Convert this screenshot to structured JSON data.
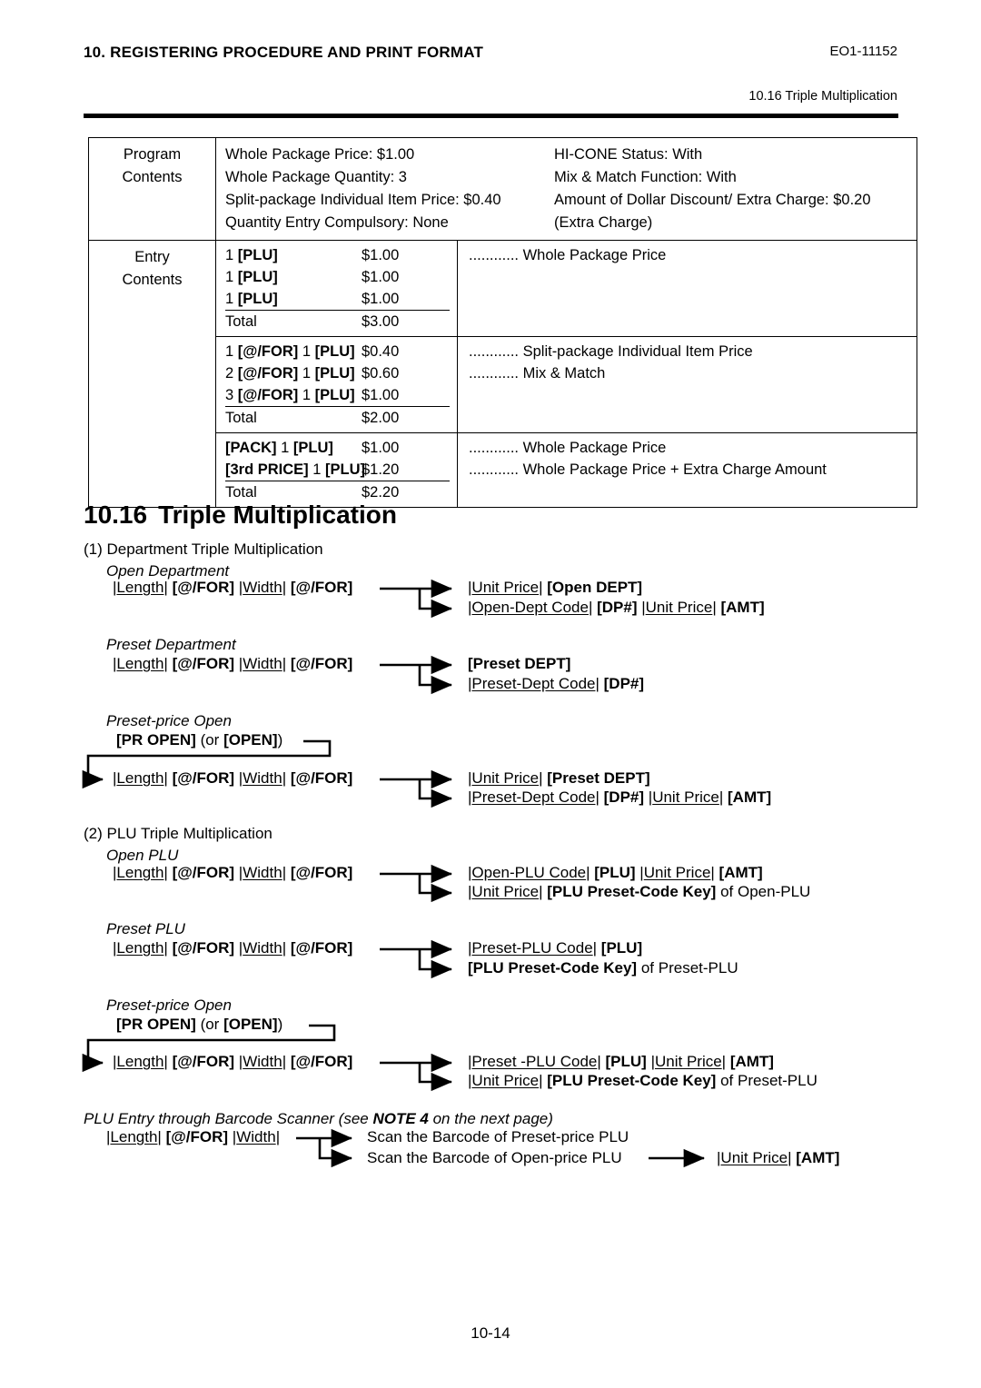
{
  "header": {
    "title": "10. REGISTERING PROCEDURE AND PRINT FORMAT",
    "doc_code": "EO1-11152",
    "subtitle": "10.16 Triple Multiplication"
  },
  "table": {
    "program_label_line1": "Program",
    "program_label_line2": "Contents",
    "program_rows": [
      {
        "left": "Whole Package Price: $1.00",
        "right": "HI-CONE Status: With"
      },
      {
        "left": "Whole Package Quantity: 3",
        "right": "Mix & Match Function: With"
      },
      {
        "left": "Split-package Individual Item Price: $0.40",
        "right": "Amount of Dollar Discount/ Extra Charge: $0.20"
      },
      {
        "left": "Quantity Entry Compulsory: None",
        "right": " (Extra Charge)"
      }
    ],
    "entry_label_line1": "Entry",
    "entry_label_line2": "Contents",
    "entry_blocks": [
      {
        "lines": [
          {
            "op_plain": "1 ",
            "op_bold": "[PLU]",
            "amount": "$1.00",
            "underline": false,
            "note": "............ Whole Package Price"
          },
          {
            "op_plain": "1 ",
            "op_bold": "[PLU]",
            "amount": "$1.00",
            "underline": false,
            "note": ""
          },
          {
            "op_plain": "1 ",
            "op_bold": "[PLU]",
            "amount": "$1.00",
            "underline": true,
            "note": ""
          },
          {
            "op_plain": "Total",
            "op_bold": "",
            "amount": "$3.00",
            "underline": false,
            "note": ""
          }
        ]
      },
      {
        "lines": [
          {
            "op_plain": "1 ",
            "op_bold": "[@/FOR]",
            "op_tail": " 1 ",
            "op_bold2": "[PLU]",
            "amount": "$0.40",
            "underline": false,
            "note": "............ Split-package Individual Item Price"
          },
          {
            "op_plain": "2 ",
            "op_bold": "[@/FOR]",
            "op_tail": " 1 ",
            "op_bold2": "[PLU]",
            "amount": "$0.60",
            "underline": false,
            "note": ""
          },
          {
            "op_plain": "3 ",
            "op_bold": "[@/FOR]",
            "op_tail": " 1 ",
            "op_bold2": "[PLU]",
            "amount": "$1.00",
            "underline": true,
            "note": "............ Mix & Match"
          },
          {
            "op_plain": "Total",
            "op_bold": "",
            "amount": "$2.00",
            "underline": false,
            "note": ""
          }
        ]
      },
      {
        "lines": [
          {
            "op_plain": "",
            "op_bold": "[PACK]",
            "op_tail": " 1 ",
            "op_bold2": "[PLU]",
            "amount": "$1.00",
            "underline": false,
            "note": "............ Whole Package Price"
          },
          {
            "op_plain": "",
            "op_bold": "[3rd PRICE]",
            "op_tail": " 1 ",
            "op_bold2": "[PLU]",
            "amount": "$1.20",
            "underline": true,
            "note": "............ Whole Package Price + Extra Charge Amount"
          },
          {
            "op_plain": "Total",
            "op_bold": "",
            "amount": "$2.20",
            "underline": false,
            "note": ""
          }
        ]
      }
    ]
  },
  "section": {
    "number": "10.16",
    "title": "Triple Multiplication"
  },
  "dept": {
    "item_label": "(1) Department Triple Multiplication",
    "open_heading": "Open Department",
    "open_seq_length": "Length",
    "open_seq_forkey": "[@/FOR]",
    "open_seq_width": "Width",
    "open_result_1_a": "Unit Price",
    "open_result_1_b": "[Open DEPT]",
    "open_result_2_a": "Open-Dept Code",
    "open_result_2_b": "[DP#]",
    "open_result_2_c": "Unit Price",
    "open_result_2_d": "[AMT]",
    "preset_heading": "Preset Department",
    "preset_result_1": "[Preset DEPT]",
    "preset_result_2_a": "Preset-Dept Code",
    "preset_result_2_b": "[DP#]",
    "pro_heading": "Preset-price Open",
    "pro_key_a": "[PR OPEN]",
    "pro_key_mid": " (or ",
    "pro_key_b": "[OPEN]",
    "pro_key_end": ")",
    "pro_result_1_a": "Unit Price",
    "pro_result_1_b": "[Preset DEPT]",
    "pro_result_2_a": "Preset-Dept Code",
    "pro_result_2_b": "[DP#]",
    "pro_result_2_c": "Unit Price",
    "pro_result_2_d": "[AMT]"
  },
  "plu": {
    "item_label": "(2) PLU Triple Multiplication",
    "open_heading": "Open PLU",
    "open_result_1_a": "Open-PLU Code",
    "open_result_1_b": "[PLU]",
    "open_result_1_c": "Unit Price",
    "open_result_1_d": "[AMT]",
    "open_result_2_a": "Unit Price",
    "open_result_2_b": "[PLU Preset-Code Key]",
    "open_result_2_c": " of Open-PLU",
    "preset_heading": "Preset PLU",
    "preset_result_1_a": "Preset-PLU Code",
    "preset_result_1_b": "[PLU]",
    "preset_result_2_a": "[PLU Preset-Code Key]",
    "preset_result_2_b": " of Preset-PLU",
    "pro_heading": "Preset-price Open",
    "pro_key_a": "[PR OPEN]",
    "pro_key_mid": " (or ",
    "pro_key_b": "[OPEN]",
    "pro_key_end": ")",
    "pro_result_1_a": "Preset -PLU Code",
    "pro_result_1_b": "[PLU]",
    "pro_result_1_c": "Unit Price",
    "pro_result_1_d": "[AMT]",
    "pro_result_2_a": "Unit Price",
    "pro_result_2_b": "[PLU Preset-Code Key]",
    "pro_result_2_c": " of Preset-PLU"
  },
  "barcode": {
    "heading_a": "PLU Entry through Barcode Scanner (see ",
    "heading_b": "NOTE 4",
    "heading_c": " on the next page)",
    "seq_length": "Length",
    "seq_forkey": "[@/FOR]",
    "seq_width": "Width",
    "result_1": "Scan the Barcode of Preset-price PLU",
    "result_2": "Scan the Barcode of Open-price PLU",
    "result_3_a": "Unit Price",
    "result_3_b": "[AMT]"
  },
  "footer": {
    "page_number": "10-14"
  },
  "common": {
    "forkey": "[@/FOR]"
  }
}
